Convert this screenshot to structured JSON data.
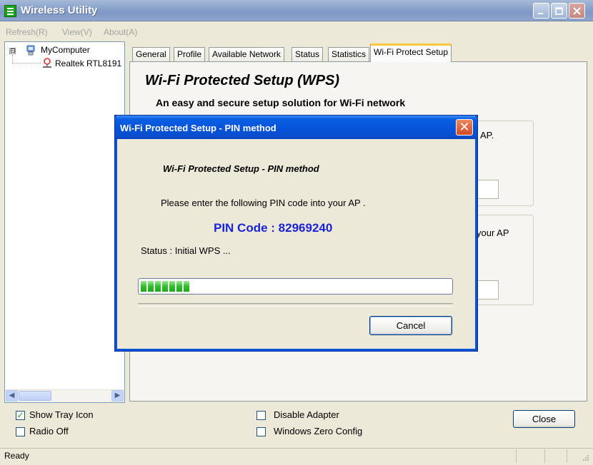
{
  "window": {
    "title": "Wireless Utility",
    "minimize_icon": "minimize-icon",
    "maximize_icon": "maximize-icon",
    "close_icon": "close-icon"
  },
  "menu": [
    "Refresh(R)",
    "View(V)",
    "About(A)"
  ],
  "tree": {
    "root_label": "MyComputer",
    "expander": "⊟",
    "child_label": "Realtek RTL8191"
  },
  "tabs": {
    "items": [
      "General",
      "Profile",
      "Available Network",
      "Status",
      "Statistics",
      "Wi-Fi Protect Setup"
    ],
    "active_index": 5
  },
  "wps": {
    "title": "Wi-Fi Protected Setup (WPS)",
    "subtitle": "An easy and secure setup solution for Wi-Fi network",
    "peek_text_1": "AP.",
    "peek_text_2": "your AP"
  },
  "bottom": {
    "show_tray_icon": {
      "label": "Show Tray Icon",
      "checked": true
    },
    "radio_off": {
      "label": "Radio Off",
      "checked": false
    },
    "disable_adapter": {
      "label": "Disable Adapter",
      "checked": false
    },
    "windows_zero_config": {
      "label": "Windows Zero Config",
      "checked": false
    },
    "close_label": "Close"
  },
  "statusbar": {
    "text": "Ready"
  },
  "dialog": {
    "title": "Wi-Fi Protected Setup - PIN method",
    "heading": "Wi-Fi Protected Setup - PIN method",
    "message": "Please enter the following PIN code into your AP .",
    "pin_line": "PIN Code :  82969240",
    "status": "Status :  Initial WPS ...",
    "progress_blocks_filled": 7,
    "cancel_label": "Cancel",
    "close_glyph": "✕"
  },
  "colors": {
    "titlebar": "#8aa3cc",
    "dialog_titlebar": "#0553d9",
    "pin_text": "#1a24d6",
    "active_tab_accent": "#ffc83c",
    "progress_fill": "#2fbf2a"
  }
}
